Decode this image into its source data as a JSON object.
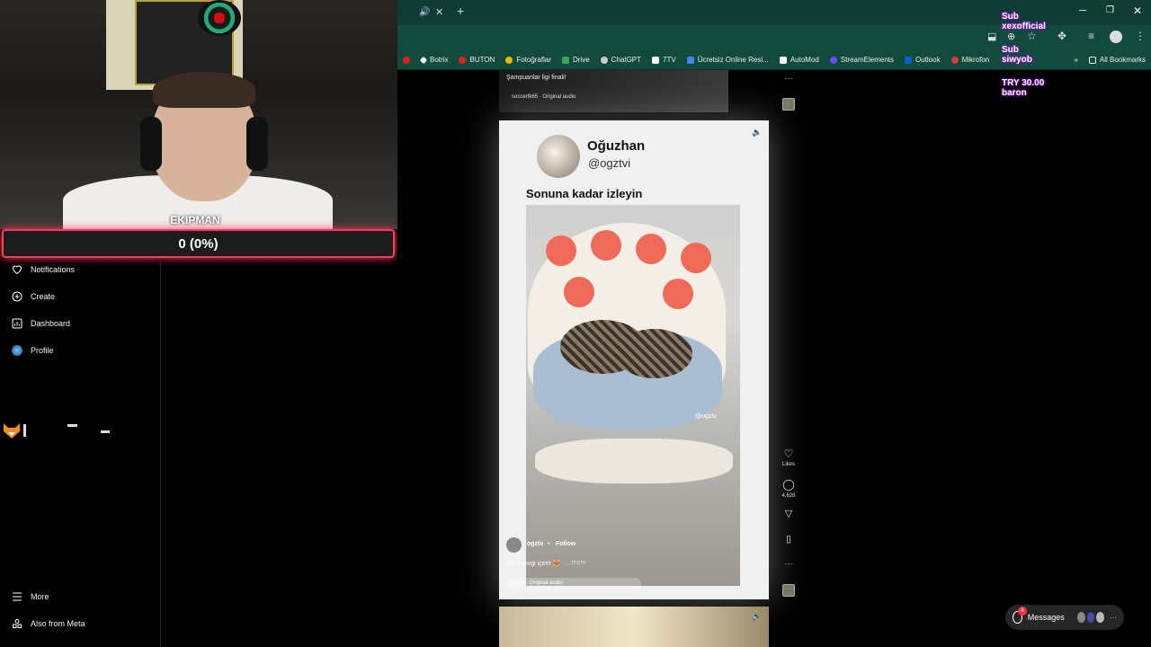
{
  "webcam": {
    "label": "EKIPMAN"
  },
  "goal_bar": {
    "text": "0 (0%)",
    "progress": 0,
    "accent": "#ff3b5c"
  },
  "sidebar": {
    "items": [
      {
        "label": "Notifications",
        "icon": "heart-icon"
      },
      {
        "label": "Create",
        "icon": "plus-square-icon"
      },
      {
        "label": "Dashboard",
        "icon": "chart-icon"
      },
      {
        "label": "Profile",
        "icon": "avatar"
      }
    ],
    "bottom": [
      {
        "label": "More",
        "icon": "menu-icon"
      },
      {
        "label": "Also from Meta",
        "icon": "meta-icon"
      }
    ]
  },
  "chrome": {
    "bookmarks": [
      {
        "label": "Botrix",
        "color": "#ffffff"
      },
      {
        "label": "BUTON",
        "color": "#e02020"
      },
      {
        "label": "Fotoğraflar",
        "color": "#f4b400"
      },
      {
        "label": "Drive",
        "color": "#34a853"
      },
      {
        "label": "ChatGPT",
        "color": "#cccccc"
      },
      {
        "label": "7TV",
        "color": "#ffffff"
      },
      {
        "label": "Ücretsiz Online Resi...",
        "color": "#4285f4"
      },
      {
        "label": "AutoMod",
        "color": "#ffffff"
      },
      {
        "label": "StreamElements",
        "color": "#6b4cff"
      },
      {
        "label": "Outlook",
        "color": "#0a64c8"
      },
      {
        "label": "Mikrofon",
        "color": "#d0403a"
      }
    ],
    "all_bookmarks": "All Bookmarks"
  },
  "feed": {
    "top_post": {
      "caption": "Şampuanlar ligi finali!",
      "audio": "soccerfk65 · Original audio"
    },
    "main_post": {
      "header_name": "Oğuzhan",
      "header_handle": "@ogztvi",
      "title": "Sonuna kadar izleyin",
      "watermark": "@ogztv",
      "author": "ogztv",
      "follow": "Follow",
      "caption": "Aşırı sevgi içerir 😻",
      "more": "... more",
      "audio": "ogztv · Original audio"
    },
    "actions": {
      "likes": "Likes",
      "comments": "4,628"
    }
  },
  "messages": {
    "label": "Messages",
    "badge": "4"
  },
  "stream_alerts": [
    "Sub",
    "xexofficial",
    "Sub",
    "siwyob",
    "TRY 30.00",
    "baron"
  ]
}
